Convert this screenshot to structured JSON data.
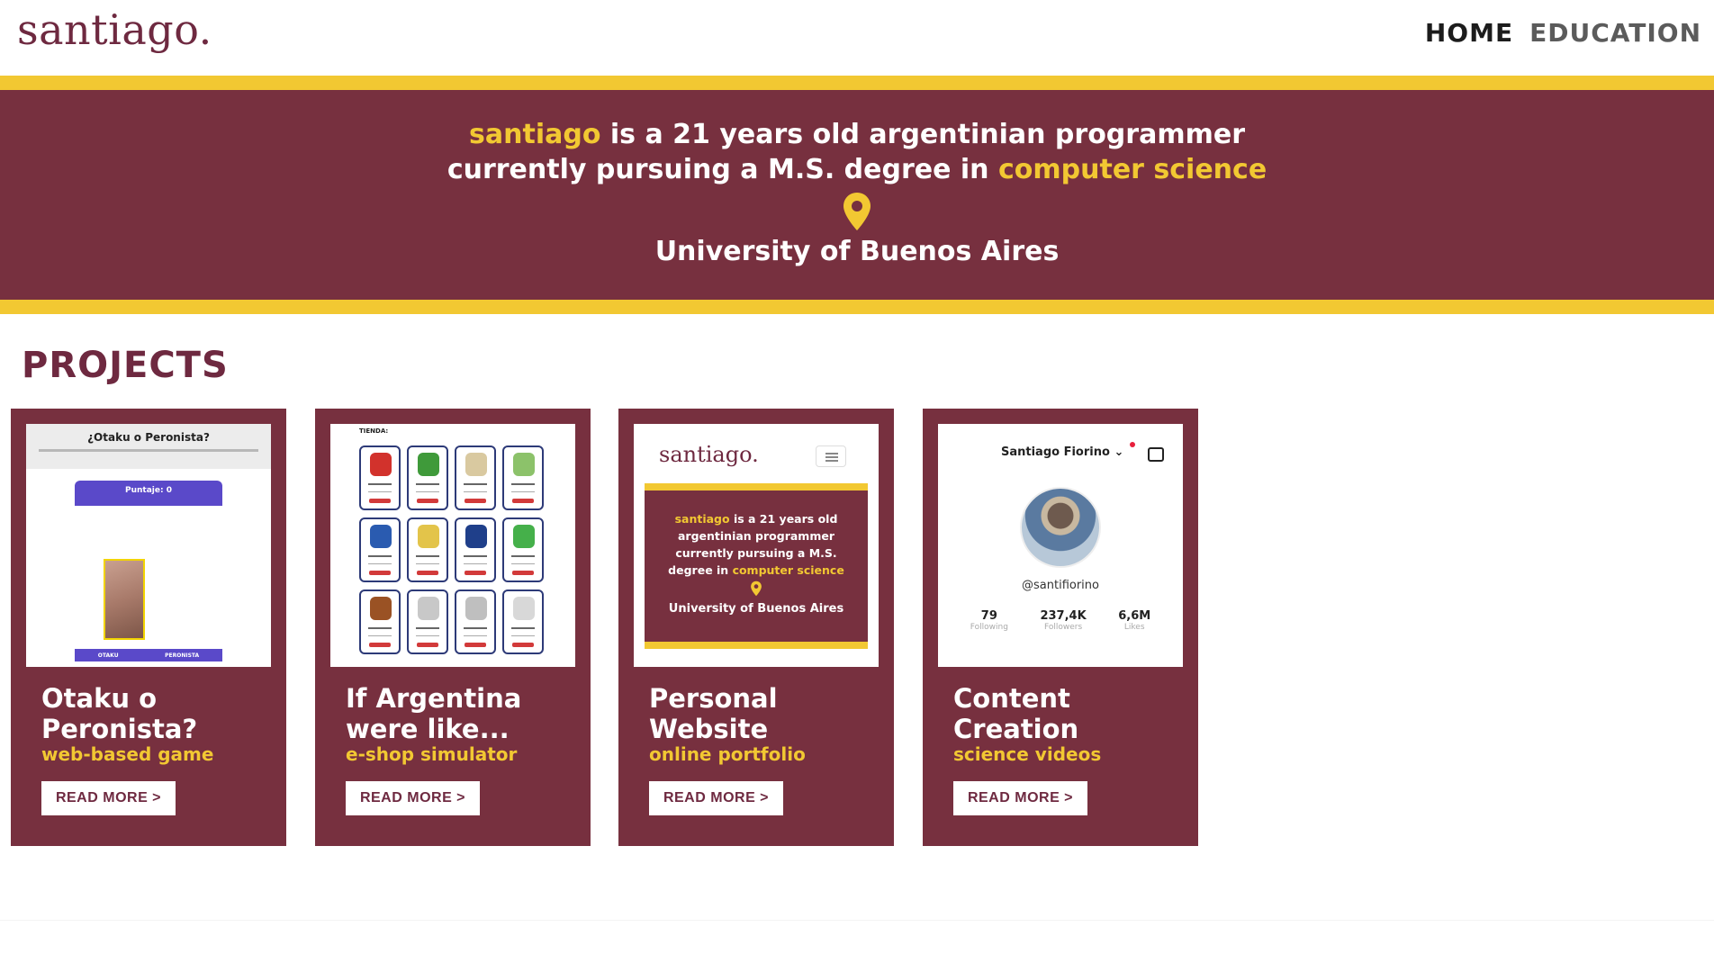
{
  "header": {
    "logo": "santiago.",
    "nav": [
      {
        "label": "HOME",
        "active": true
      },
      {
        "label": "EDUCATION",
        "active": false
      }
    ]
  },
  "hero": {
    "name": "santiago",
    "line1_rest": " is a 21 years old argentinian programmer",
    "line2_start": "currently pursuing a M.S. degree in ",
    "field": "computer science",
    "university": "University of Buenos Aires",
    "icon": "location-pin-icon"
  },
  "colors": {
    "maroon": "#77303f",
    "yellow": "#f2c832",
    "white": "#ffffff"
  },
  "projects": {
    "title": "PROJECTS",
    "cards": [
      {
        "title_line1": "Otaku o",
        "title_line2": "Peronista?",
        "subtitle": "web-based game",
        "button": "READ MORE >",
        "thumb": {
          "title": "¿Otaku o Peronista?",
          "score": "Puntaje: 0",
          "option_a": "OTAKU",
          "option_b": "PERONISTA"
        }
      },
      {
        "title_line1": "If Argentina",
        "title_line2": "were like...",
        "subtitle": "e-shop simulator",
        "button": "READ MORE >",
        "thumb": {
          "label": "TIENDA:"
        }
      },
      {
        "title_line1": "Personal",
        "title_line2": "Website",
        "subtitle": "online portfolio",
        "button": "READ MORE >",
        "thumb": {
          "logo": "santiago.",
          "name": "santiago",
          "text_a": " is a 21 years old",
          "text_b": "argentinian programmer",
          "text_c": "currently pursuing a M.S.",
          "text_d": "degree in ",
          "field": "computer science",
          "university": "University of Buenos Aires"
        }
      },
      {
        "title_line1": "Content",
        "title_line2": "Creation",
        "subtitle": "science videos",
        "button": "READ MORE >",
        "thumb": {
          "name": "Santiago Fiorino ⌄",
          "handle": "@santifiorino",
          "stats": [
            {
              "value": "79",
              "label": "Following"
            },
            {
              "value": "237,4K",
              "label": "Followers"
            },
            {
              "value": "6,6M",
              "label": "Likes"
            }
          ]
        }
      }
    ]
  }
}
